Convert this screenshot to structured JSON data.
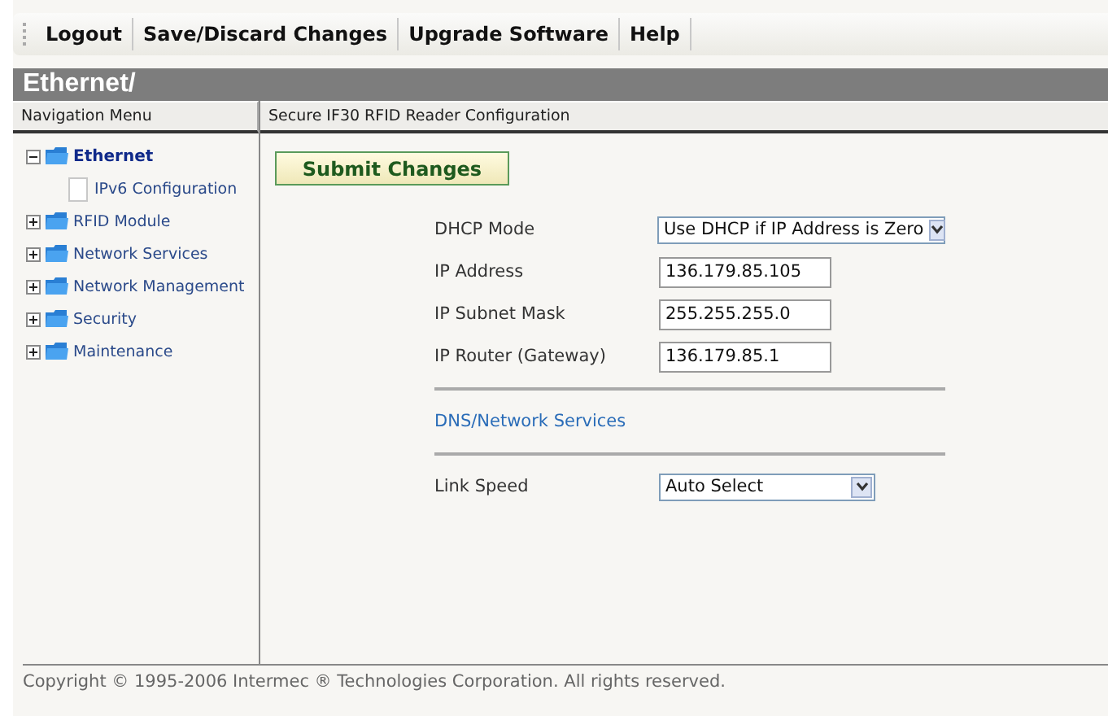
{
  "toolbar": [
    "Logout",
    "Save/Discard Changes",
    "Upgrade Software",
    "Help"
  ],
  "page_title": "Ethernet/",
  "sidebar": {
    "heading": "Navigation Menu",
    "items": [
      {
        "label": "Ethernet",
        "expanded": true,
        "selected": true,
        "children": [
          {
            "label": "IPv6 Configuration",
            "selected": false
          }
        ]
      },
      {
        "label": "RFID Module",
        "expanded": false,
        "selected": false
      },
      {
        "label": "Network Services",
        "expanded": false,
        "selected": false
      },
      {
        "label": "Network Management",
        "expanded": false,
        "selected": false
      },
      {
        "label": "Security",
        "expanded": false,
        "selected": false
      },
      {
        "label": "Maintenance",
        "expanded": false,
        "selected": false
      }
    ]
  },
  "content": {
    "heading": "Secure IF30 RFID Reader Configuration",
    "submit_button": "Submit Changes",
    "sections": [
      {
        "kind": "fields",
        "fields": [
          {
            "label": "DHCP Mode",
            "kind": "select",
            "value": "Use DHCP if IP Address is Zero"
          },
          {
            "label": "IP Address",
            "kind": "input",
            "value": "136.179.85.105"
          },
          {
            "label": "IP Subnet Mask",
            "kind": "input",
            "value": "255.255.255.0"
          },
          {
            "label": "IP Router (Gateway)",
            "kind": "input",
            "value": "136.179.85.1"
          }
        ]
      },
      {
        "kind": "link",
        "label": "DNS/Network Services"
      },
      {
        "kind": "fields",
        "fields": [
          {
            "label": "Link Speed",
            "kind": "select",
            "value": "Auto Select"
          }
        ]
      }
    ]
  },
  "footer": "Copyright © 1995-2006 Intermec ® Technologies Corporation. All rights reserved."
}
